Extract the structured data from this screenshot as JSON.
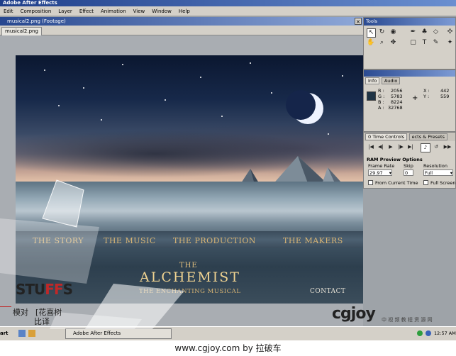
{
  "window": {
    "title": "Adobe After Effects"
  },
  "menu": [
    "Edit",
    "Composition",
    "Layer",
    "Effect",
    "Animation",
    "View",
    "Window",
    "Help"
  ],
  "footage": {
    "title": "musical2.png (Footage)",
    "tab": "musical2.png"
  },
  "scene": {
    "nav": [
      "THE STORY",
      "THE MUSIC",
      "THE PRODUCTION",
      "THE MAKERS"
    ],
    "title_the": "THE",
    "title_main": "ALCHEMIST",
    "subtitle": "THE ENCHANTING MUSICAL",
    "contact": "CONTACT"
  },
  "tools_panel": {
    "title": "Tools"
  },
  "info_panel": {
    "tabs": [
      "Info",
      "Audio"
    ],
    "r_label": "R :",
    "r_value": "2056",
    "g_label": "G :",
    "g_value": "5783",
    "b_label": "B :",
    "b_value": "8224",
    "a_label": "A :",
    "a_value": "32768",
    "x_label": "X :",
    "x_value": "442",
    "y_label": "Y :",
    "y_value": "559",
    "swatch_color": "#1f3446"
  },
  "time_controls": {
    "tabs": [
      "0 Time Controls",
      "ects & Presets"
    ],
    "section_title": "RAM Preview Options",
    "frame_rate_label": "Frame Rate",
    "frame_rate_value": "29.97",
    "skip_label": "Skip",
    "skip_value": "0",
    "resolution_label": "Resolution",
    "resolution_value": "Full",
    "from_current_time_label": "From Current Time",
    "full_screen_label": "Full Screen"
  },
  "taskbar": {
    "start": "art",
    "item": "Adobe After Effects",
    "clock": "12:57 AM"
  },
  "overlay": {
    "stuffs_a": "STU",
    "stuffs_b": "FF",
    "stuffs_c": "S",
    "cn_1": "模对",
    "cn_2": "[花喜树",
    "cn_3": "比译",
    "cgjoy": "cgjoy",
    "cgjoy_sub": "中 视 频 教 程 资 源 网"
  },
  "footer": {
    "text": "www.cgjoy.com by 拉破车"
  },
  "colors": {
    "accent_gold": "#d9b574",
    "brand_red": "#c02828"
  }
}
